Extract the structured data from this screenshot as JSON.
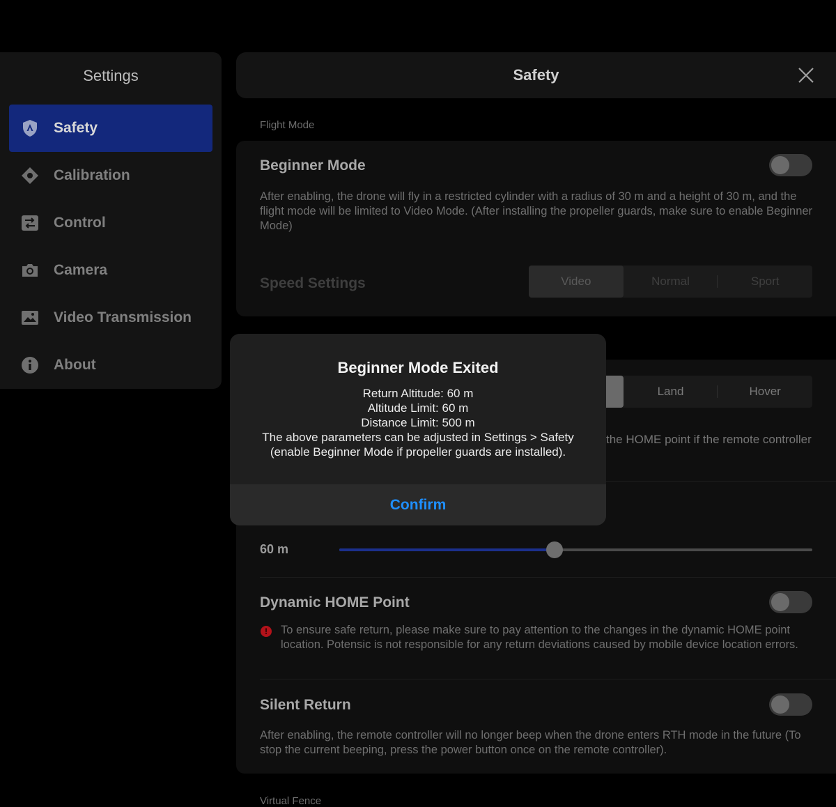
{
  "sidebar": {
    "title": "Settings",
    "items": [
      {
        "label": "Safety",
        "icon": "shield-icon",
        "active": true
      },
      {
        "label": "Calibration",
        "icon": "crosshair-icon"
      },
      {
        "label": "Control",
        "icon": "control-icon"
      },
      {
        "label": "Camera",
        "icon": "camera-icon"
      },
      {
        "label": "Video Transmission",
        "icon": "video-transmission-icon"
      },
      {
        "label": "About",
        "icon": "info-icon"
      }
    ]
  },
  "header": {
    "title": "Safety",
    "close_icon": "close-icon"
  },
  "flight_mode": {
    "section_label": "Flight Mode",
    "beginner": {
      "title": "Beginner Mode",
      "desc": "After enabling, the drone will fly in a restricted cylinder with a radius of 30 m and a height of 30 m, and the flight mode will be limited to Video Mode. (After installing the propeller guards, make sure to enable Beginner Mode)",
      "enabled": false
    },
    "speed": {
      "title": "Speed Settings",
      "options": [
        "Video",
        "Normal",
        "Sport"
      ],
      "selected": "Video"
    }
  },
  "rth": {
    "options": [
      "Land",
      "Hover"
    ],
    "desc_fragment": "the HOME point if the remote controller"
  },
  "altitude": {
    "value_label": "60 m",
    "fraction": 0.455
  },
  "dynamic_home": {
    "title": "Dynamic HOME Point",
    "warning": "To ensure safe return, please make sure to pay attention to the changes in the dynamic HOME point location. Potensic is not responsible for any return deviations caused by mobile device location errors.",
    "enabled": false,
    "warning_color": "#b3121a"
  },
  "silent_return": {
    "title": "Silent Return",
    "desc": "After enabling, the remote controller will no longer beep when the drone enters RTH mode in the future (To stop the current beeping, press the power button once on the remote controller).",
    "enabled": false
  },
  "virtual_fence": {
    "section_label": "Virtual Fence"
  },
  "dialog": {
    "title": "Beginner Mode Exited",
    "lines": [
      "Return Altitude: 60 m",
      "Altitude Limit: 60 m",
      "Distance Limit: 500 m",
      "The above parameters can be adjusted in Settings > Safety",
      "(enable Beginner Mode if propeller guards are installed)."
    ],
    "confirm": "Confirm",
    "accent": "#1f8fff"
  }
}
